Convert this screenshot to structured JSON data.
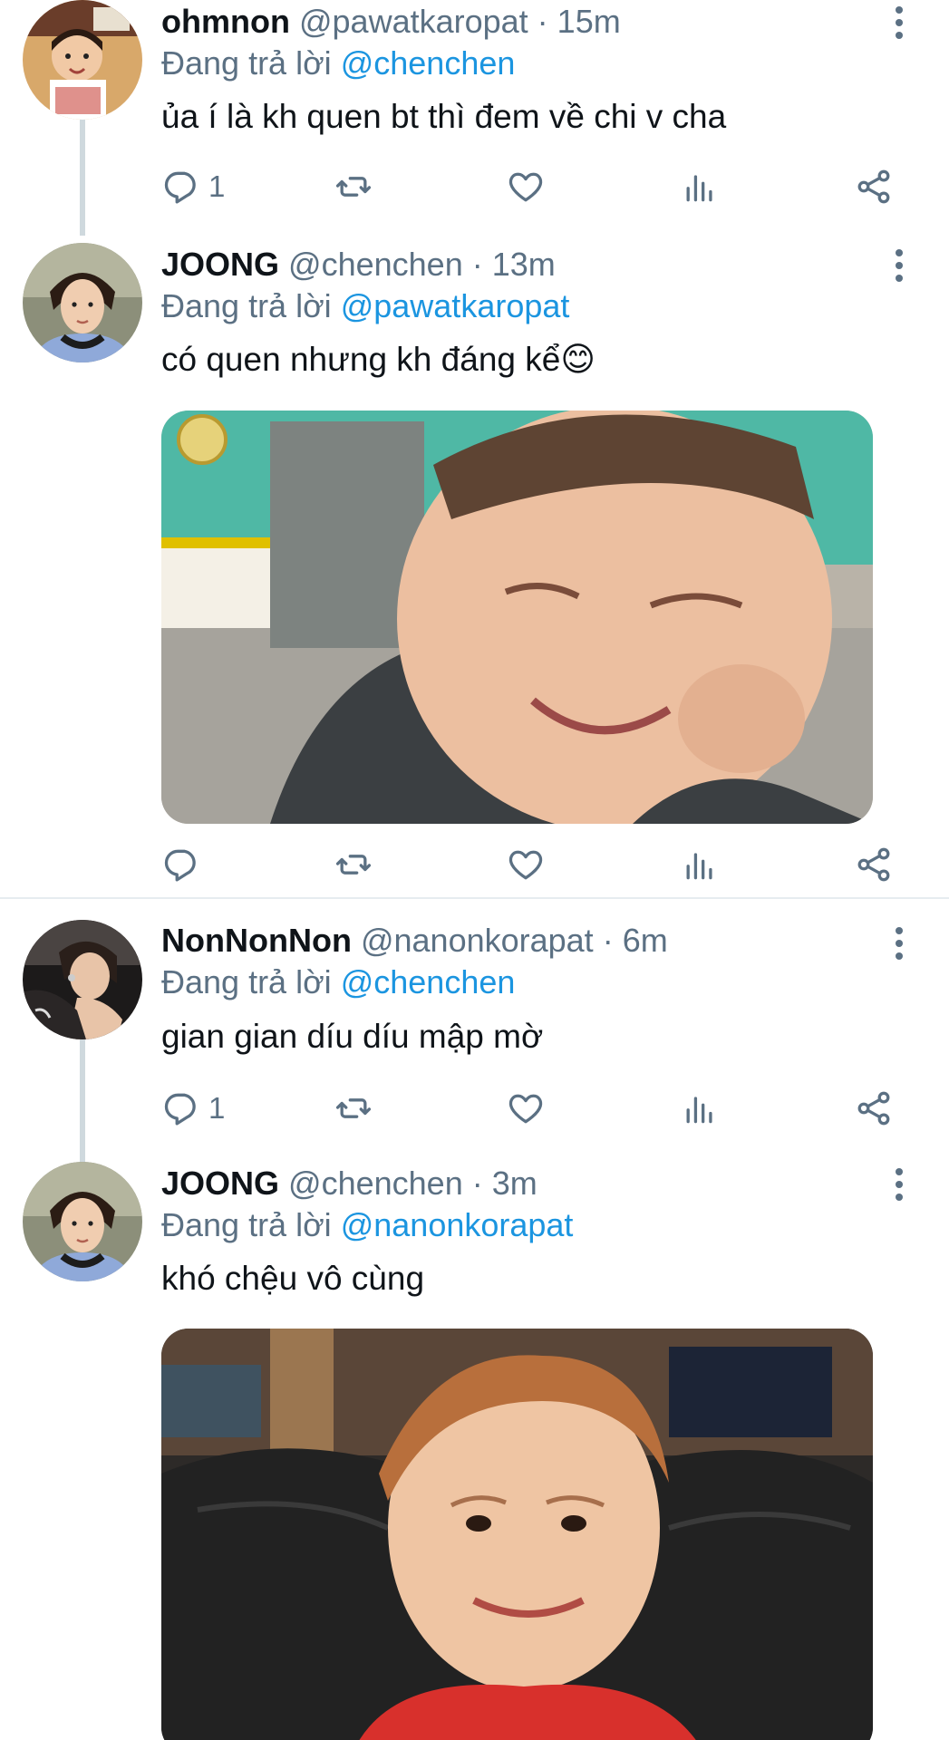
{
  "tweets": [
    {
      "name": "ohmnon",
      "handle": "@pawatkaropat",
      "time": "15m",
      "replying_prefix": "Đang trả lời",
      "replying_to": "@chenchen",
      "text": "ủa í là kh quen bt thì đem về chi v cha",
      "reply_count": "1"
    },
    {
      "name": "JOONG",
      "handle": "@chenchen",
      "time": "13m",
      "replying_prefix": "Đang trả lời",
      "replying_to": "@pawatkaropat",
      "text": "có quen nhưng kh đáng kể😊",
      "reply_count": ""
    },
    {
      "name": "NonNonNon",
      "handle": "@nanonkorapat",
      "time": "6m",
      "replying_prefix": "Đang trả lời",
      "replying_to": "@chenchen",
      "text": "gian gian díu díu mập mờ",
      "reply_count": "1"
    },
    {
      "name": "JOONG",
      "handle": "@chenchen",
      "time": "3m",
      "replying_prefix": "Đang trả lời",
      "replying_to": "@nanonkorapat",
      "text": "khó chệu vô cùng",
      "reply_count": ""
    }
  ],
  "separator": " · ",
  "colors": {
    "link": "#1b95e0",
    "secondary": "#5b7083",
    "primary": "#0f1419",
    "divider": "#e6ecf0"
  },
  "icons": [
    "reply-icon",
    "retweet-icon",
    "like-icon",
    "analytics-icon",
    "share-icon",
    "more-icon"
  ]
}
